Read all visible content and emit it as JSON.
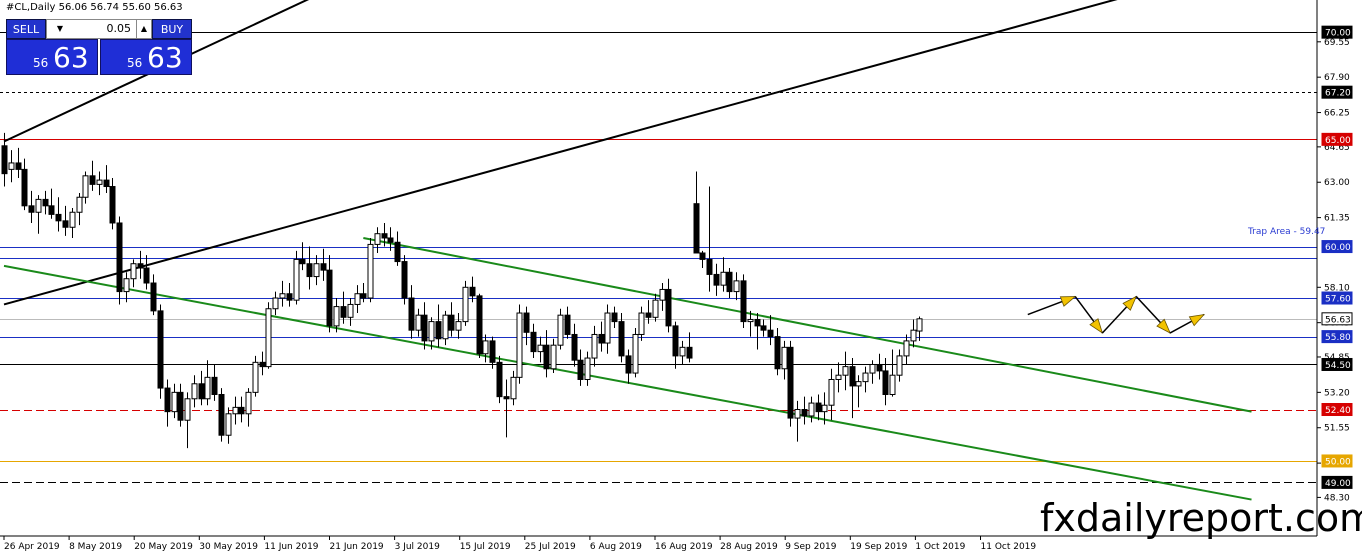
{
  "chart_title": "#CL,Daily  56.06 56.74 55.60 56.63",
  "trade_panel": {
    "sell_label": "SELL",
    "buy_label": "BUY",
    "lot_value": "0.05",
    "sell_price_small": "56",
    "sell_price_big": "63",
    "buy_price_small": "56",
    "buy_price_big": "63"
  },
  "watermark": "fxdailyreport.com",
  "chart_data": {
    "type": "candlestick",
    "title": "#CL,Daily  56.06 56.74 55.60 56.63",
    "symbol": "#CL",
    "timeframe": "Daily",
    "ohlc_header": {
      "open": 56.06,
      "high": 56.74,
      "low": 55.6,
      "close": 56.63
    },
    "ylim": [
      46.5,
      71.5
    ],
    "y_ticks": [
      "69.55",
      "67.90",
      "66.25",
      "64.65",
      "63.00",
      "61.35",
      "58.10",
      "56.45",
      "54.85",
      "53.20",
      "51.55",
      "49.90",
      "48.30"
    ],
    "x_ticks": [
      "26 Apr 2019",
      "8 May 2019",
      "20 May 2019",
      "30 May 2019",
      "11 Jun 2019",
      "21 Jun 2019",
      "3 Jul 2019",
      "15 Jul 2019",
      "25 Jul 2019",
      "6 Aug 2019",
      "16 Aug 2019",
      "28 Aug 2019",
      "9 Sep 2019",
      "19 Sep 2019",
      "1 Oct 2019",
      "11 Oct 2019"
    ],
    "horizontal_levels": [
      {
        "label": "70.00",
        "value": 70.0,
        "color": "#000000",
        "style": "solid"
      },
      {
        "label": "67.20",
        "value": 67.2,
        "color": "#000000",
        "style": "dotted"
      },
      {
        "label": "65.00",
        "value": 65.0,
        "color": "#d60000",
        "style": "solid"
      },
      {
        "label": "60.00",
        "value": 60.0,
        "color": "#1a2fc4",
        "style": "solid"
      },
      {
        "label": "59.47",
        "value": 59.47,
        "color": "#1a2fc4",
        "style": "solid"
      },
      {
        "label": "57.60",
        "value": 57.6,
        "color": "#1a2fc4",
        "style": "solid"
      },
      {
        "label": "56.63",
        "value": 56.63,
        "color": "#bbbbbb",
        "style": "solid"
      },
      {
        "label": "55.80",
        "value": 55.8,
        "color": "#1a2fc4",
        "style": "solid"
      },
      {
        "label": "54.50",
        "value": 54.5,
        "color": "#000000",
        "style": "solid"
      },
      {
        "label": "52.40",
        "value": 52.4,
        "color": "#d60000",
        "style": "dashed"
      },
      {
        "label": "50.00",
        "value": 50.0,
        "color": "#e6a600",
        "style": "solid"
      },
      {
        "label": "49.00",
        "value": 49.0,
        "color": "#000000",
        "style": "dashed"
      }
    ],
    "level_tags": [
      {
        "text": "70.00",
        "value": 70.0,
        "bg": "#000000",
        "fg": "#ffffff"
      },
      {
        "text": "67.20",
        "value": 67.2,
        "bg": "#000000",
        "fg": "#ffffff"
      },
      {
        "text": "65.00",
        "value": 65.0,
        "bg": "#d60000",
        "fg": "#ffffff"
      },
      {
        "text": "60.00",
        "value": 60.0,
        "bg": "#1a2fc4",
        "fg": "#ffffff"
      },
      {
        "text": "57.60",
        "value": 57.6,
        "bg": "#1a2fc4",
        "fg": "#ffffff"
      },
      {
        "text": "56.63",
        "value": 56.63,
        "bg": "#ffffff",
        "fg": "#000000"
      },
      {
        "text": "55.80",
        "value": 55.8,
        "bg": "#1a2fc4",
        "fg": "#ffffff"
      },
      {
        "text": "54.50",
        "value": 54.5,
        "bg": "#000000",
        "fg": "#ffffff"
      },
      {
        "text": "52.40",
        "value": 52.4,
        "bg": "#d60000",
        "fg": "#ffffff"
      },
      {
        "text": "50.00",
        "value": 50.0,
        "bg": "#e6a600",
        "fg": "#ffffff"
      },
      {
        "text": "49.00",
        "value": 49.0,
        "bg": "#000000",
        "fg": "#ffffff"
      }
    ],
    "trap_area_label": "Trap Area - 59.47",
    "trendlines": [
      {
        "name": "",
        "color": "#000000",
        "points": [
          [
            0,
            64.9
          ],
          [
            46,
            71.7
          ]
        ]
      },
      {
        "name": "",
        "color": "#000000",
        "points": [
          [
            0,
            57.3
          ],
          [
            166,
            71.7
          ]
        ]
      },
      {
        "name": "",
        "color": "#1a8a1a",
        "points": [
          [
            0,
            59.1
          ],
          [
            184,
            48.2
          ]
        ]
      },
      {
        "name": "",
        "color": "#1a8a1a",
        "points": [
          [
            53,
            60.4
          ],
          [
            184,
            52.3
          ]
        ]
      }
    ],
    "projection_path": [
      [
        151,
        56.83
      ],
      [
        158,
        57.67
      ],
      [
        162,
        55.97
      ],
      [
        167,
        57.67
      ],
      [
        172,
        55.97
      ],
      [
        177,
        56.83
      ]
    ],
    "candles": [
      [
        64.7,
        65.3,
        62.8,
        63.4
      ],
      [
        63.6,
        64.5,
        63.0,
        63.9
      ],
      [
        63.9,
        64.6,
        63.2,
        63.6
      ],
      [
        63.6,
        64.1,
        61.7,
        61.9
      ],
      [
        61.9,
        62.6,
        61.1,
        61.6
      ],
      [
        61.6,
        62.4,
        60.6,
        62.2
      ],
      [
        62.2,
        62.6,
        61.5,
        61.9
      ],
      [
        61.9,
        62.7,
        61.3,
        61.5
      ],
      [
        61.5,
        62.3,
        60.7,
        61.2
      ],
      [
        61.2,
        61.9,
        60.5,
        60.9
      ],
      [
        60.9,
        61.8,
        60.4,
        61.6
      ],
      [
        61.6,
        62.5,
        61.0,
        62.3
      ],
      [
        62.3,
        63.5,
        62.0,
        63.3
      ],
      [
        63.3,
        64.0,
        62.6,
        62.9
      ],
      [
        62.9,
        63.5,
        62.4,
        63.1
      ],
      [
        63.1,
        63.8,
        62.5,
        62.8
      ],
      [
        62.8,
        63.2,
        60.8,
        61.1
      ],
      [
        61.1,
        61.4,
        57.3,
        57.9
      ],
      [
        57.9,
        58.8,
        57.4,
        58.5
      ],
      [
        58.5,
        59.4,
        58.1,
        59.2
      ],
      [
        59.2,
        59.8,
        58.5,
        59.0
      ],
      [
        59.0,
        59.6,
        58.0,
        58.3
      ],
      [
        58.3,
        58.7,
        56.8,
        57.0
      ],
      [
        57.0,
        57.3,
        52.9,
        53.4
      ],
      [
        53.4,
        53.8,
        51.6,
        52.3
      ],
      [
        52.3,
        53.6,
        52.0,
        53.2
      ],
      [
        53.2,
        53.6,
        51.6,
        51.9
      ],
      [
        51.9,
        53.2,
        50.6,
        52.9
      ],
      [
        52.9,
        54.0,
        52.5,
        53.6
      ],
      [
        53.6,
        54.2,
        52.6,
        52.9
      ],
      [
        52.9,
        54.7,
        52.6,
        53.9
      ],
      [
        53.9,
        54.5,
        52.8,
        53.1
      ],
      [
        53.1,
        53.4,
        50.9,
        51.2
      ],
      [
        51.2,
        52.5,
        50.8,
        52.2
      ],
      [
        52.2,
        53.0,
        51.7,
        52.5
      ],
      [
        52.5,
        53.0,
        51.8,
        52.2
      ],
      [
        52.2,
        53.4,
        51.6,
        53.2
      ],
      [
        53.2,
        54.9,
        53.0,
        54.6
      ],
      [
        54.6,
        55.1,
        54.0,
        54.4
      ],
      [
        54.4,
        57.4,
        54.3,
        57.1
      ],
      [
        57.1,
        57.9,
        56.8,
        57.6
      ],
      [
        57.6,
        58.4,
        57.2,
        57.8
      ],
      [
        57.8,
        58.3,
        57.2,
        57.5
      ],
      [
        57.5,
        59.8,
        57.3,
        59.4
      ],
      [
        59.4,
        60.2,
        58.9,
        59.2
      ],
      [
        59.2,
        60.0,
        58.0,
        58.6
      ],
      [
        58.6,
        59.6,
        58.2,
        59.2
      ],
      [
        59.2,
        59.9,
        58.4,
        58.9
      ],
      [
        58.9,
        59.6,
        56.0,
        56.3
      ],
      [
        56.3,
        57.6,
        56.0,
        57.2
      ],
      [
        57.2,
        57.9,
        56.4,
        56.7
      ],
      [
        56.7,
        57.6,
        56.3,
        57.3
      ],
      [
        57.3,
        58.2,
        56.9,
        57.8
      ],
      [
        57.8,
        58.3,
        57.4,
        57.6
      ],
      [
        57.6,
        60.4,
        57.4,
        60.1
      ],
      [
        60.1,
        60.9,
        59.7,
        60.6
      ],
      [
        60.6,
        61.1,
        60.0,
        60.4
      ],
      [
        60.4,
        60.9,
        59.8,
        60.2
      ],
      [
        60.2,
        60.7,
        59.1,
        59.3
      ],
      [
        59.3,
        59.6,
        57.3,
        57.6
      ],
      [
        57.6,
        58.2,
        55.7,
        56.1
      ],
      [
        56.1,
        57.1,
        55.8,
        56.8
      ],
      [
        56.8,
        57.4,
        55.2,
        55.6
      ],
      [
        55.6,
        56.7,
        55.2,
        56.5
      ],
      [
        56.5,
        57.3,
        55.3,
        55.7
      ],
      [
        55.7,
        57.0,
        55.4,
        56.8
      ],
      [
        56.8,
        57.4,
        55.8,
        56.1
      ],
      [
        56.1,
        56.9,
        55.7,
        56.5
      ],
      [
        56.5,
        58.4,
        56.3,
        58.1
      ],
      [
        58.1,
        58.6,
        57.4,
        57.7
      ],
      [
        57.7,
        57.8,
        54.8,
        55.0
      ],
      [
        55.0,
        55.9,
        54.6,
        55.6
      ],
      [
        55.6,
        55.8,
        54.3,
        54.6
      ],
      [
        54.6,
        54.9,
        52.7,
        53.0
      ],
      [
        53.0,
        53.8,
        51.1,
        52.9
      ],
      [
        52.9,
        54.2,
        52.6,
        53.9
      ],
      [
        53.9,
        57.3,
        53.6,
        56.9
      ],
      [
        56.9,
        57.2,
        55.4,
        56.0
      ],
      [
        56.0,
        56.4,
        54.8,
        55.1
      ],
      [
        55.1,
        55.8,
        54.6,
        55.4
      ],
      [
        55.4,
        56.1,
        53.9,
        54.3
      ],
      [
        54.3,
        55.7,
        54.1,
        55.4
      ],
      [
        55.4,
        57.1,
        55.2,
        56.8
      ],
      [
        56.8,
        57.2,
        55.7,
        55.9
      ],
      [
        55.9,
        56.4,
        54.4,
        54.7
      ],
      [
        54.7,
        55.2,
        53.5,
        53.8
      ],
      [
        53.8,
        55.1,
        53.5,
        54.8
      ],
      [
        54.8,
        56.3,
        54.4,
        55.9
      ],
      [
        55.9,
        56.5,
        55.1,
        55.5
      ],
      [
        55.5,
        57.3,
        55.0,
        56.9
      ],
      [
        56.9,
        57.2,
        56.2,
        56.5
      ],
      [
        56.5,
        56.9,
        54.6,
        54.9
      ],
      [
        54.9,
        55.2,
        53.6,
        54.1
      ],
      [
        54.1,
        56.2,
        53.9,
        55.9
      ],
      [
        55.9,
        57.2,
        55.6,
        56.9
      ],
      [
        56.9,
        57.5,
        56.4,
        56.7
      ],
      [
        56.7,
        57.8,
        56.5,
        57.5
      ],
      [
        57.5,
        58.3,
        57.0,
        58.0
      ],
      [
        58.0,
        58.5,
        56.0,
        56.3
      ],
      [
        56.3,
        56.5,
        54.3,
        54.9
      ],
      [
        54.9,
        55.6,
        54.5,
        55.3
      ],
      [
        55.3,
        56.0,
        54.6,
        54.8
      ],
      [
        62.0,
        63.5,
        61.6,
        59.7
      ],
      [
        59.7,
        59.8,
        59.0,
        59.4
      ],
      [
        59.4,
        62.8,
        57.9,
        58.7
      ],
      [
        58.7,
        59.2,
        57.7,
        58.2
      ],
      [
        58.2,
        59.5,
        57.9,
        58.8
      ],
      [
        58.8,
        59.0,
        57.6,
        57.9
      ],
      [
        57.9,
        58.8,
        57.5,
        58.4
      ],
      [
        58.4,
        58.7,
        56.2,
        56.5
      ],
      [
        56.5,
        57.0,
        55.8,
        56.6
      ],
      [
        56.6,
        56.9,
        55.2,
        56.3
      ],
      [
        56.3,
        56.6,
        55.8,
        56.1
      ],
      [
        56.1,
        56.8,
        55.4,
        55.8
      ],
      [
        55.8,
        56.2,
        54.0,
        54.3
      ],
      [
        54.3,
        55.6,
        53.8,
        55.3
      ],
      [
        55.3,
        55.6,
        51.6,
        52.0
      ],
      [
        52.0,
        52.8,
        50.9,
        52.4
      ],
      [
        52.4,
        53.0,
        51.7,
        52.1
      ],
      [
        52.1,
        53.0,
        51.8,
        52.7
      ],
      [
        52.7,
        53.1,
        51.9,
        52.3
      ],
      [
        52.3,
        53.2,
        51.7,
        52.6
      ],
      [
        52.6,
        54.3,
        51.9,
        53.8
      ],
      [
        53.8,
        54.6,
        53.2,
        54.0
      ],
      [
        54.0,
        55.1,
        53.3,
        54.4
      ],
      [
        54.4,
        54.8,
        52.0,
        53.5
      ],
      [
        53.5,
        54.0,
        52.5,
        53.7
      ],
      [
        53.7,
        54.4,
        53.2,
        54.1
      ],
      [
        54.1,
        54.7,
        53.6,
        54.5
      ],
      [
        54.5,
        55.0,
        53.8,
        54.2
      ],
      [
        54.2,
        54.8,
        52.6,
        53.1
      ],
      [
        53.1,
        55.2,
        53.0,
        54.0
      ],
      [
        54.0,
        55.2,
        53.7,
        54.9
      ],
      [
        54.9,
        55.9,
        54.5,
        55.6
      ],
      [
        55.6,
        56.6,
        55.3,
        56.1
      ],
      [
        56.06,
        56.74,
        55.6,
        56.63
      ]
    ]
  }
}
